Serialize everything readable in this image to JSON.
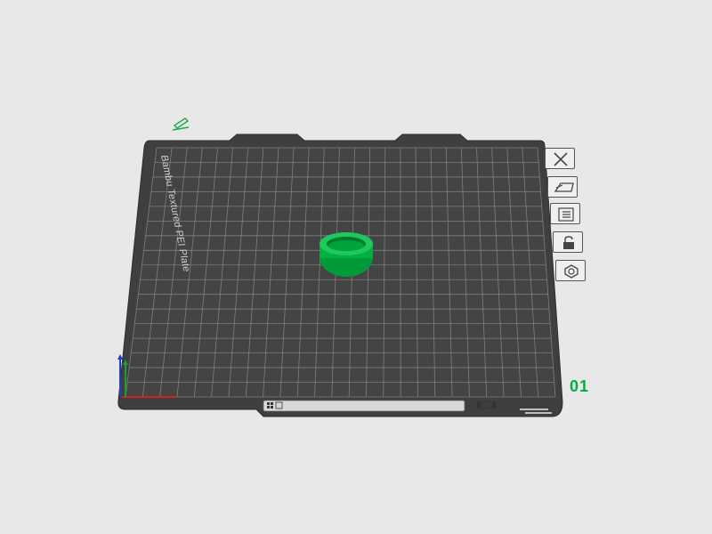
{
  "plate": {
    "label": "Bambu Textured PEI Plate",
    "number": "01"
  },
  "toolbar": [
    {
      "icon": "close-icon"
    },
    {
      "icon": "auto-orient-icon"
    },
    {
      "icon": "arrange-icon"
    },
    {
      "icon": "lock-icon"
    },
    {
      "icon": "settings-icon"
    }
  ],
  "colors": {
    "background": "#e8e8e8",
    "plate": "#3f3f3f",
    "grid": "#8a8a8a",
    "object": "#00ae42",
    "axis_x": "#d21f1f",
    "axis_y": "#1f9d3a",
    "axis_z": "#1f3dbf"
  }
}
